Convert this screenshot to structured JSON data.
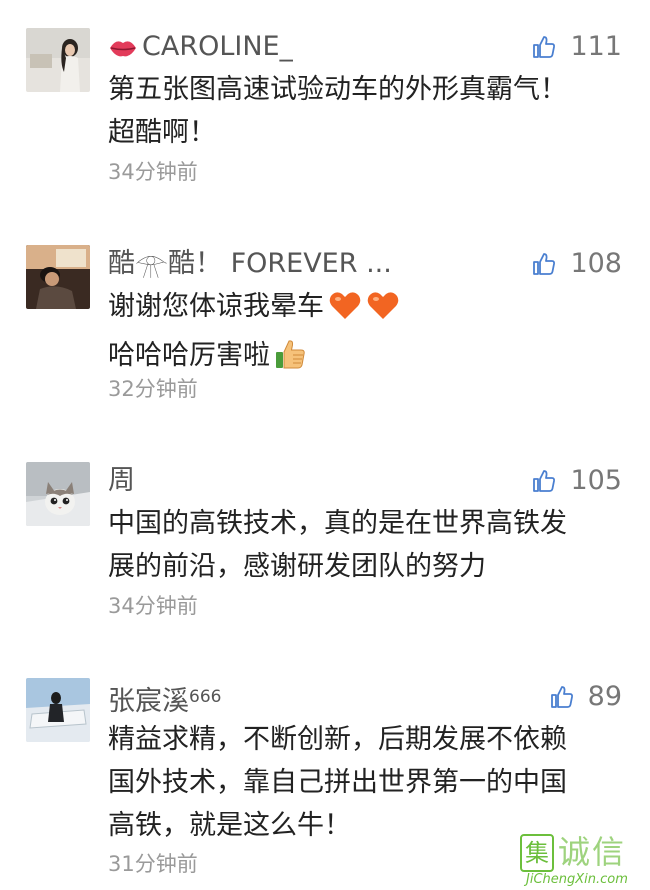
{
  "comments": [
    {
      "username": "CAROLINE_",
      "has_lips_icon": true,
      "likes": "111",
      "lines": [
        "第五张图高速试验动车的外形真霸气！",
        "超酷啊！"
      ],
      "time": "34分钟前"
    },
    {
      "username": "酷𓁿酷！ FOREVER ...",
      "likes": "108",
      "lines": [
        "谢谢您体谅我晕车",
        "哈哈哈厉害啦"
      ],
      "line_emojis": [
        [
          "heart-emoji",
          "heart-emoji"
        ],
        [
          "thumbs-up-emoji"
        ]
      ],
      "time": "32分钟前"
    },
    {
      "username": "周",
      "likes": "105",
      "lines": [
        "中国的高铁技术，真的是在世界高铁发",
        "展的前沿，感谢研发团队的努力"
      ],
      "time": "34分钟前"
    },
    {
      "username": "张宸溪",
      "username_sup": "666",
      "likes": "89",
      "lines": [
        "精益求精，不断创新，后期发展不依赖",
        "国外技术，靠自己拼出世界第一的中国",
        "高铁，就是这么牛！"
      ],
      "time": "31分钟前"
    }
  ],
  "watermark": {
    "box_char": "集",
    "chars": "诚信",
    "url": "JiChengXin.com"
  },
  "colors": {
    "username": "#555555",
    "text": "#222222",
    "time": "#9a9a9a",
    "like_icon": "#4a7fd0",
    "like_count": "#777777",
    "heart": "#f26522",
    "watermark": "#6cbf3c"
  },
  "icons": [
    "lips-icon",
    "like-thumb-icon",
    "heart-emoji",
    "thumbs-up-emoji"
  ]
}
